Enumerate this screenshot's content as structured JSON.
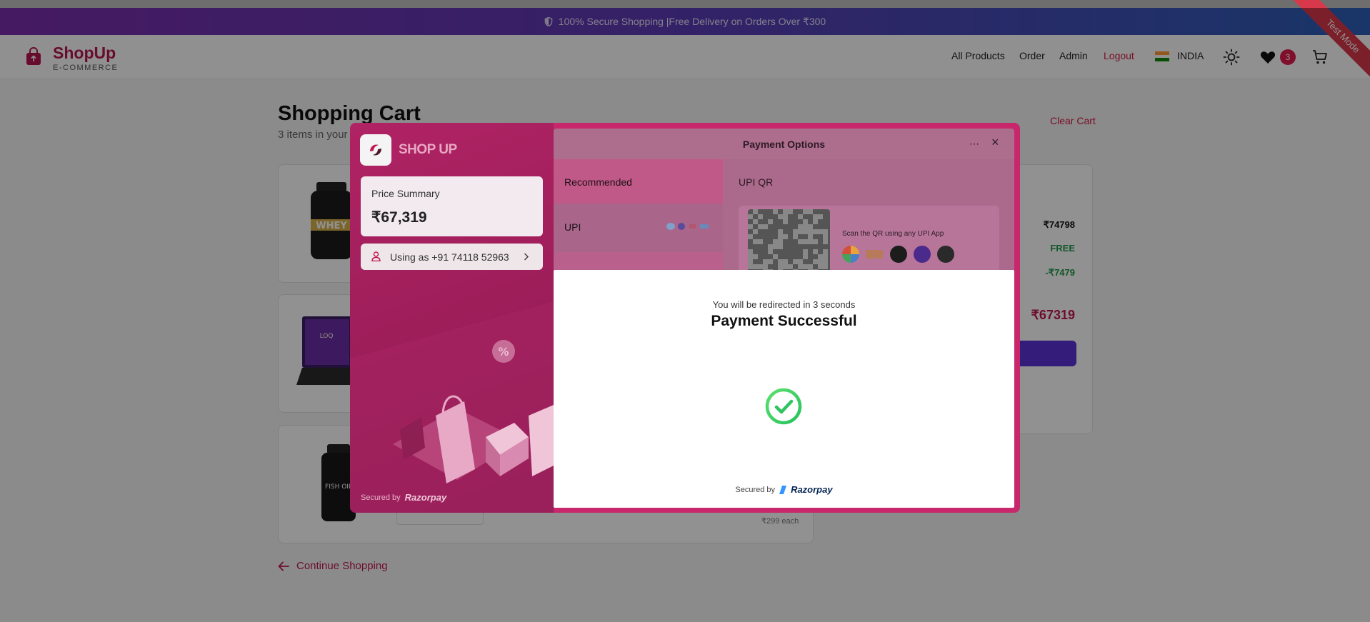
{
  "promo_banner": {
    "text": "100% Secure Shopping |Free Delivery on Orders Over ₹300"
  },
  "header": {
    "brand": "ShopUp",
    "brand_sub": "E-COMMERCE",
    "nav": [
      "All Products",
      "Order",
      "Admin",
      "Logout"
    ],
    "country": "INDIA",
    "wishlist_count": "3",
    "ribbon": "Test Mode"
  },
  "cart": {
    "title": "Shopping Cart",
    "subtitle": "3 items in your",
    "clear_label": "Clear Cart",
    "continue_label": "Continue Shopping",
    "item_price_each": "₹299 each",
    "summary": {
      "subtotal": "₹74798",
      "shipping": "FREE",
      "discount": "-₹7479",
      "total": "₹67319"
    }
  },
  "payment": {
    "merchant": "SHOP UP",
    "price_summary_label": "Price Summary",
    "amount": "₹67,319",
    "using_as": "Using as +91 74118 52963",
    "secured_by": "Secured by",
    "provider": "Razorpay",
    "options_title": "Payment Options",
    "tabs": [
      "Recommended",
      "UPI"
    ],
    "upi_qr_label": "UPI QR",
    "scan_text": "Scan the QR using any UPI App"
  },
  "success": {
    "redirect": "You will be redirected in 3 seconds",
    "title": "Payment Successful",
    "secured_by": "Secured by",
    "provider": "Razorpay"
  },
  "colors": {
    "brand": "#b8164f",
    "razorpay_theme": "#c8286b",
    "success_green": "#3dd36b"
  }
}
